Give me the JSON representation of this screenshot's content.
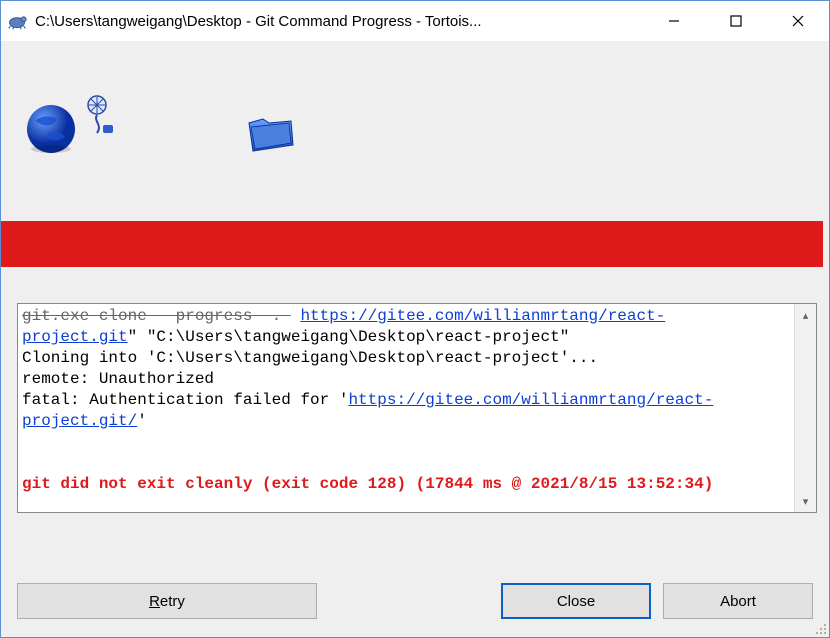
{
  "window": {
    "title": "C:\\Users\\tangweigang\\Desktop - Git Command Progress - Tortois..."
  },
  "log": {
    "line1_link": "https://gitee.com/willianmrtang/react-",
    "line2_link_tail": "project.git",
    "line2_rest": "\" \"C:\\Users\\tangweigang\\Desktop\\react-project\"",
    "line3": "Cloning into 'C:\\Users\\tangweigang\\Desktop\\react-project'...",
    "line4": "remote: Unauthorized",
    "line5_pre": "fatal: Authentication failed for '",
    "line5_link_a": "https://gitee.com/willianmrtang/react-",
    "line6_link_b": "project.git/",
    "line6_post": "'",
    "error": "git did not exit cleanly (exit code 128) (17844 ms @ 2021/8/15 13:52:34)"
  },
  "buttons": {
    "retry_u": "R",
    "retry_rest": "etry",
    "close": "Close",
    "abort": "Abort"
  }
}
